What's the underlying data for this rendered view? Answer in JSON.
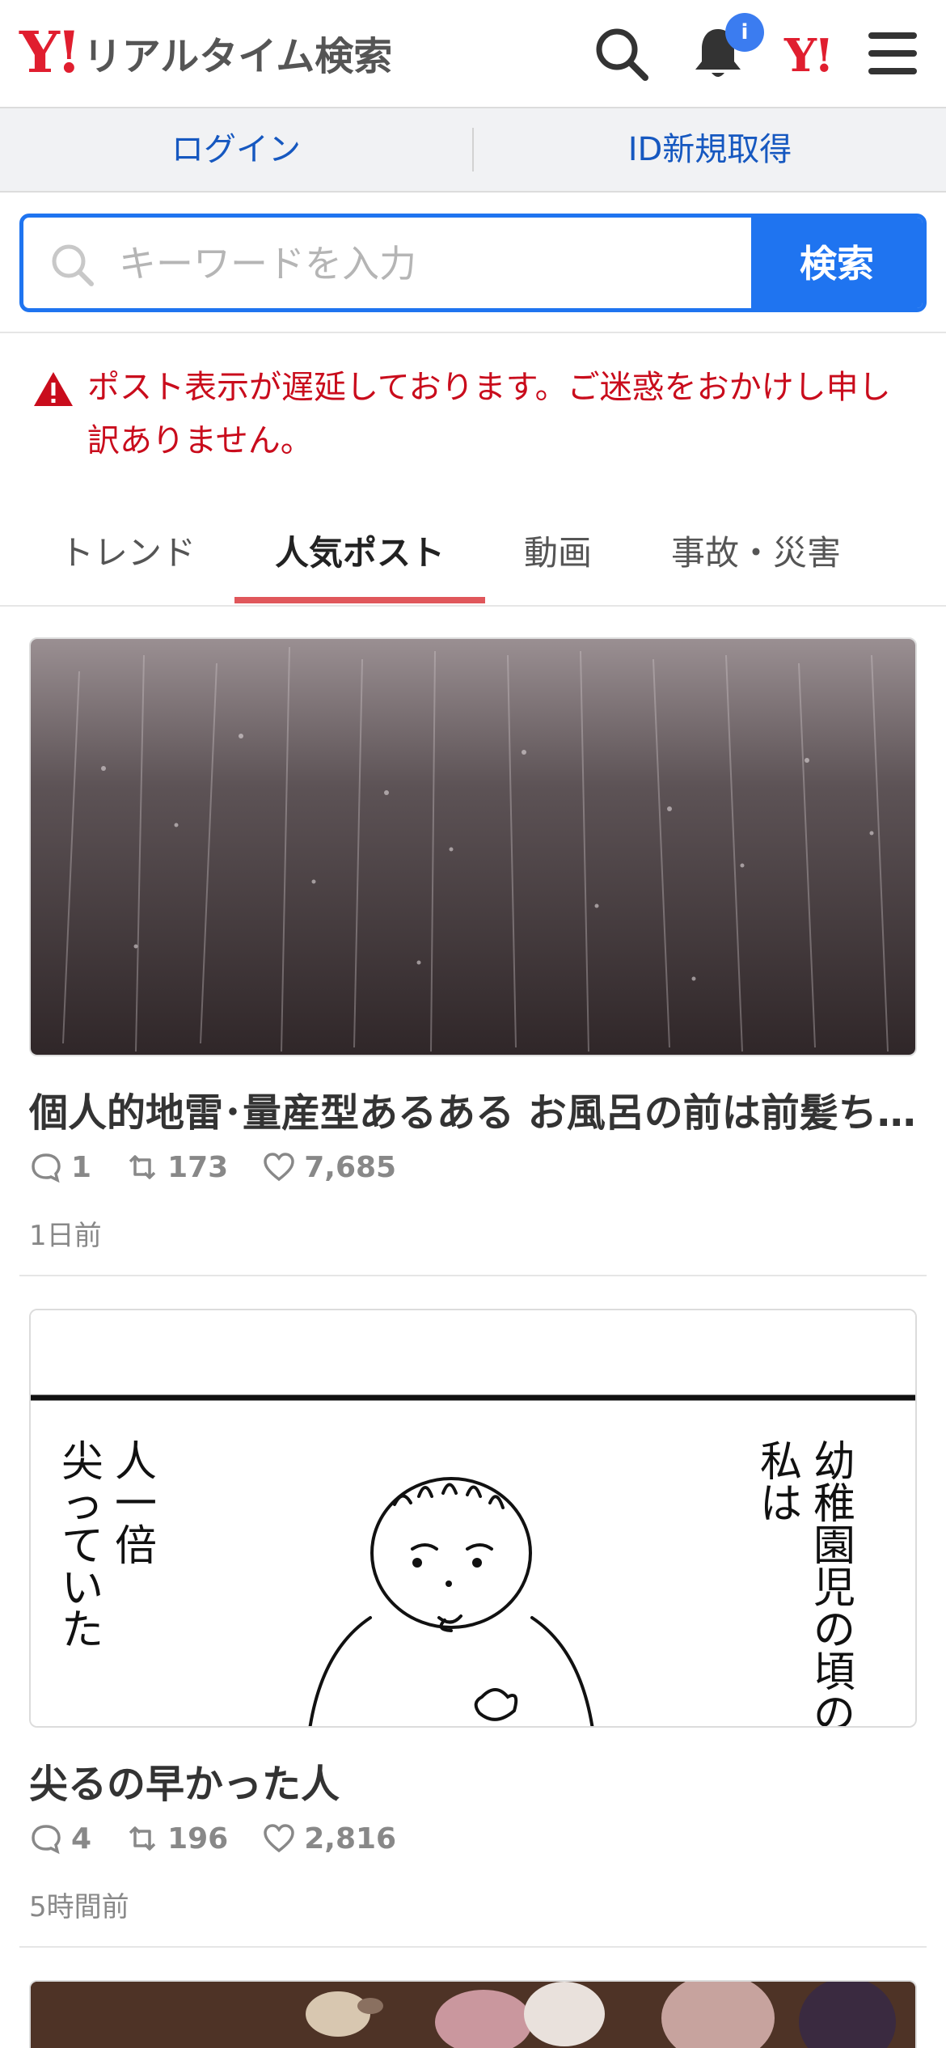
{
  "header": {
    "logo_mark": "Y!",
    "title": "リアルタイム検索",
    "badge": "i",
    "yahoo_mark": "Y!",
    "icons": [
      "search-icon",
      "bell-icon",
      "yahoo-logo-icon",
      "menu-icon"
    ]
  },
  "auth": {
    "login": "ログイン",
    "register": "ID新規取得"
  },
  "search": {
    "placeholder": "キーワードを入力",
    "button": "検索"
  },
  "notice": {
    "text": "ポスト表示が遅延しております。ご迷惑をおかけし申し訳ありません。"
  },
  "tabs": [
    {
      "label": "トレンド",
      "active": false
    },
    {
      "label": "人気ポスト",
      "active": true
    },
    {
      "label": "動画",
      "active": false
    },
    {
      "label": "事故・災害",
      "active": false
    }
  ],
  "posts": [
    {
      "title": "個人的地雷･量産型あるある お風呂の前は前髪ちゃんと...",
      "replies": "1",
      "reposts": "173",
      "likes": "7,685",
      "time": "1日前"
    },
    {
      "title": "尖るの早かった人",
      "replies": "4",
      "reposts": "196",
      "likes": "2,816",
      "time": "5時間前",
      "image_text": {
        "right_vertical_1": "幼稚園児の頃の",
        "right_vertical_2": "私は",
        "left_vertical_1": "人一倍",
        "left_vertical_2": "尖っていた"
      }
    }
  ],
  "colors": {
    "brand_red": "#e01e2f",
    "link_blue": "#1658c0",
    "search_blue": "#1f74f0",
    "alert_red": "#c90c1c",
    "tab_underline": "#e0575b"
  }
}
